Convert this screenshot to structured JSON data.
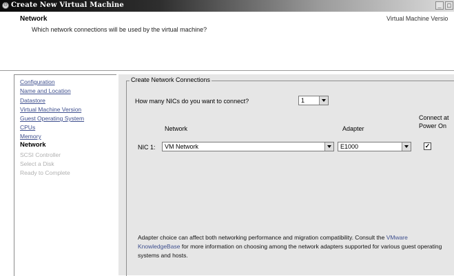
{
  "window": {
    "title": "Create New Virtual Machine",
    "controls": [
      "_",
      "□"
    ]
  },
  "header": {
    "title": "Network",
    "subtitle": "Which network connections will be used by the virtual machine?",
    "right_text": "Virtual Machine Versio"
  },
  "sidebar": {
    "items": [
      {
        "label": "Configuration",
        "state": "link"
      },
      {
        "label": "Name and Location",
        "state": "link"
      },
      {
        "label": "Datastore",
        "state": "link"
      },
      {
        "label": "Virtual Machine Version",
        "state": "link"
      },
      {
        "label": "Guest Operating System",
        "state": "link"
      },
      {
        "label": "CPUs",
        "state": "link"
      },
      {
        "label": "Memory",
        "state": "link"
      },
      {
        "label": "Network",
        "state": "current"
      },
      {
        "label": "SCSI Controller",
        "state": "disabled"
      },
      {
        "label": "Select a Disk",
        "state": "disabled"
      },
      {
        "label": "Ready to Complete",
        "state": "disabled"
      }
    ]
  },
  "main": {
    "group_title": "Create Network Connections",
    "nic_question": "How many NICs do you want to connect?",
    "nic_count": "1",
    "col_network": "Network",
    "col_adapter": "Adapter",
    "col_connect_line1": "Connect at",
    "col_connect_line2": "Power On",
    "nic_label": "NIC 1:",
    "nic_network": "VM Network",
    "nic_adapter": "E1000",
    "connect_checked": "✓",
    "note_part1": "Adapter choice can affect both networking performance and migration compatibility. Consult the",
    "note_link": "VMware KnowledgeBase",
    "note_part2": "for more information on choosing among the network adapters supported for various guest operating systems and hosts."
  }
}
